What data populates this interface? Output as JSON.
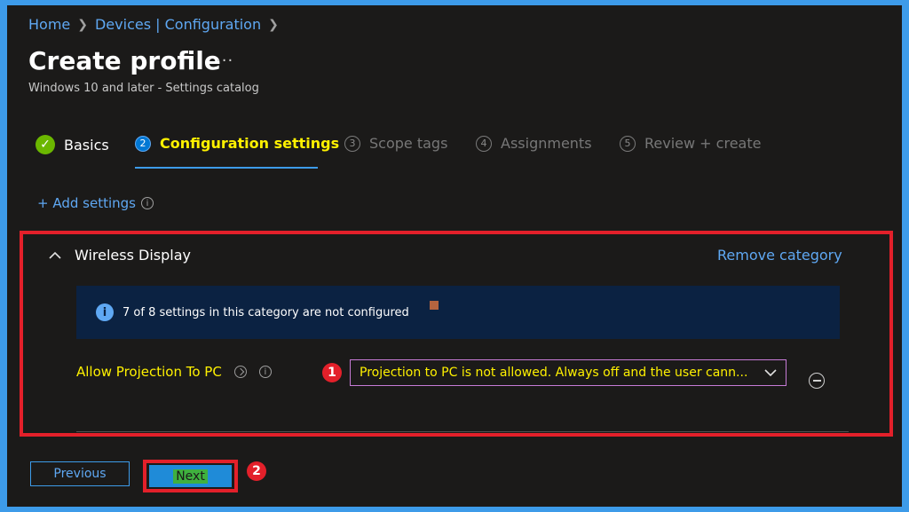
{
  "breadcrumb": {
    "items": [
      "Home",
      "Devices | Configuration"
    ]
  },
  "page": {
    "title": "Create profile",
    "more_label": "···",
    "subtitle": "Windows 10 and later - Settings catalog"
  },
  "tabs": [
    {
      "label": "Basics",
      "state": "done"
    },
    {
      "number": "2",
      "label": "Configuration settings",
      "state": "active"
    },
    {
      "number": "3",
      "label": "Scope tags",
      "state": "pending"
    },
    {
      "number": "4",
      "label": "Assignments",
      "state": "pending"
    },
    {
      "number": "5",
      "label": "Review + create",
      "state": "pending"
    }
  ],
  "add_settings": {
    "label": "+ Add settings"
  },
  "category": {
    "title": "Wireless Display",
    "remove_label": "Remove category",
    "banner_text": "7 of 8 settings in this category are not configured",
    "setting": {
      "label": "Allow Projection To PC",
      "value": "Projection to PC is not allowed. Always off and the user cann..."
    }
  },
  "annotations": {
    "step1": "1",
    "step2": "2"
  },
  "footer": {
    "previous_label": "Previous",
    "next_label": "Next"
  },
  "colors": {
    "accent": "#3d9be9",
    "highlight_text": "#fff100",
    "annotation_red": "#e3202a",
    "success_green": "#6bb700",
    "background": "#1b1a19"
  }
}
